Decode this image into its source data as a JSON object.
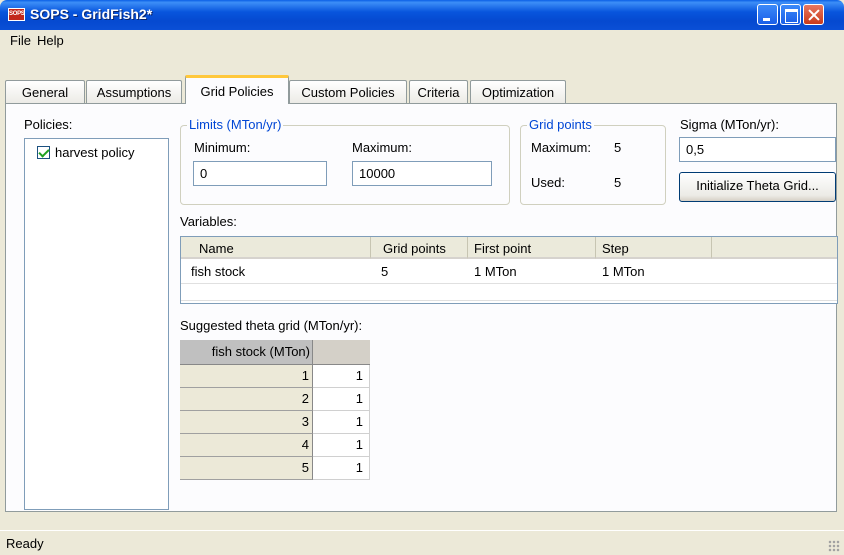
{
  "window": {
    "icon_label": "SOPS",
    "title": "SOPS - GridFish2*"
  },
  "menu": {
    "file": "File",
    "help": "Help"
  },
  "tabs": [
    {
      "label": "General"
    },
    {
      "label": "Assumptions"
    },
    {
      "label": "Grid Policies"
    },
    {
      "label": "Custom Policies"
    },
    {
      "label": "Criteria"
    },
    {
      "label": "Optimization"
    }
  ],
  "active_tab": "Grid Policies",
  "policies": {
    "label": "Policies:",
    "items": [
      {
        "label": "harvest policy",
        "checked": true
      }
    ]
  },
  "limits": {
    "title": "Limits (MTon/yr)",
    "minimum_label": "Minimum:",
    "minimum_value": "0",
    "maximum_label": "Maximum:",
    "maximum_value": "10000"
  },
  "grid_points": {
    "title": "Grid points",
    "maximum_label": "Maximum:",
    "maximum_value": "5",
    "used_label": "Used:",
    "used_value": "5"
  },
  "sigma": {
    "label": "Sigma (MTon/yr):",
    "value": "0,5",
    "init_button": "Initialize Theta Grid..."
  },
  "variables": {
    "label": "Variables:",
    "columns": [
      "Name",
      "Grid points",
      "First point",
      "Step"
    ],
    "rows": [
      [
        "fish stock",
        "5",
        "1 MTon",
        "1 MTon"
      ]
    ]
  },
  "theta": {
    "label": "Suggested theta grid (MTon/yr):",
    "column_header": "fish stock (MTon)",
    "rows": [
      {
        "key": "1",
        "value": "1"
      },
      {
        "key": "2",
        "value": "1"
      },
      {
        "key": "3",
        "value": "1"
      },
      {
        "key": "4",
        "value": "1"
      },
      {
        "key": "5",
        "value": "1"
      }
    ]
  },
  "status": {
    "text": "Ready"
  }
}
